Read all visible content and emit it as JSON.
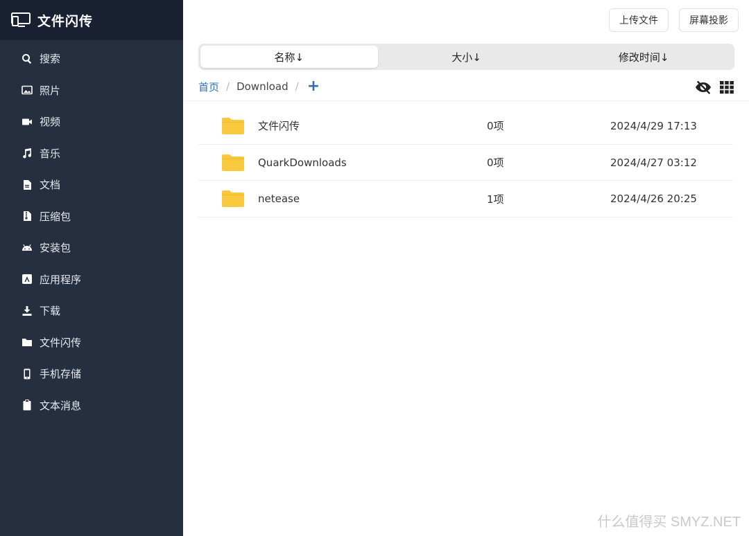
{
  "app": {
    "title": "文件闪传"
  },
  "sidebar": {
    "items": [
      {
        "label": "搜索",
        "icon": "search-icon"
      },
      {
        "label": "照片",
        "icon": "photo-icon"
      },
      {
        "label": "视频",
        "icon": "video-icon"
      },
      {
        "label": "音乐",
        "icon": "music-icon"
      },
      {
        "label": "文档",
        "icon": "document-icon"
      },
      {
        "label": "压缩包",
        "icon": "archive-icon"
      },
      {
        "label": "安装包",
        "icon": "android-icon"
      },
      {
        "label": "应用程序",
        "icon": "app-store-icon"
      },
      {
        "label": "下载",
        "icon": "download-icon"
      },
      {
        "label": "文件闪传",
        "icon": "folder-icon"
      },
      {
        "label": "手机存储",
        "icon": "phone-icon"
      },
      {
        "label": "文本消息",
        "icon": "clipboard-icon"
      }
    ]
  },
  "toolbar": {
    "upload_label": "上传文件",
    "cast_label": "屏幕投影"
  },
  "sort": {
    "tabs": [
      {
        "label": "名称↓",
        "active": true
      },
      {
        "label": "大小↓",
        "active": false
      },
      {
        "label": "修改时间↓",
        "active": false
      }
    ]
  },
  "breadcrumb": {
    "home": "首页",
    "sep": "/",
    "current": "Download",
    "add": "+"
  },
  "files": [
    {
      "name": "文件闪传",
      "count": "0项",
      "modified": "2024/4/29 17:13"
    },
    {
      "name": "QuarkDownloads",
      "count": "0项",
      "modified": "2024/4/27 03:12"
    },
    {
      "name": "netease",
      "count": "1项",
      "modified": "2024/4/26 20:25"
    }
  ],
  "colors": {
    "sidebar": "#252f40",
    "brand_bar": "#182031",
    "accent": "#2f6fb3",
    "folder": "#f8c93e"
  },
  "watermark": "什么值得买 SMYZ.NET"
}
